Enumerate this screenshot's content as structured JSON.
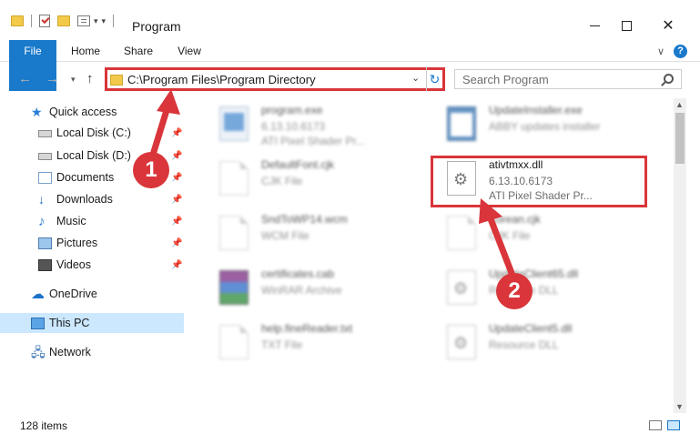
{
  "window": {
    "title": "Program",
    "minimize_icon": "minimize-icon",
    "maximize_icon": "maximize-icon",
    "close_label": "✕"
  },
  "ribbon": {
    "tabs": [
      {
        "label": "File"
      },
      {
        "label": "Home"
      },
      {
        "label": "Share"
      },
      {
        "label": "View"
      }
    ],
    "collapse_label": "∨",
    "help_label": "?"
  },
  "address": {
    "path": "C:\\Program Files\\Program Directory",
    "search_placeholder": "Search Program"
  },
  "nav": {
    "quick_access": "Quick access",
    "items": [
      {
        "label": "Local Disk (C:)"
      },
      {
        "label": "Local Disk (D:)"
      },
      {
        "label": "Documents"
      },
      {
        "label": "Downloads"
      },
      {
        "label": "Music"
      },
      {
        "label": "Pictures"
      },
      {
        "label": "Videos"
      }
    ],
    "onedrive": "OneDrive",
    "this_pc": "This PC",
    "network": "Network"
  },
  "files": [
    {
      "name": "program.exe",
      "line2": "6.13.10.6173",
      "line3": "ATI Pixel Shader Pr...",
      "icon": "exe-icon"
    },
    {
      "name": "UpdateInstaller.exe",
      "line2": "ABBY updates installer",
      "line3": "",
      "icon": "installer-icon"
    },
    {
      "name": "DefaultFont.cjk",
      "line2": "CJK File",
      "line3": "",
      "icon": "file-icon"
    },
    {
      "name": "ativtmxx.dll",
      "line2": "6.13.10.6173",
      "line3": "ATI Pixel Shader Pr...",
      "icon": "dll-gear-icon"
    },
    {
      "name": "SndToWP14.wcm",
      "line2": "WCM File",
      "line3": "",
      "icon": "file-icon"
    },
    {
      "name": "Korean.cjk",
      "line2": "CJK File",
      "line3": "",
      "icon": "file-icon"
    },
    {
      "name": "certificates.cab",
      "line2": "WinRAR Archive",
      "line3": "",
      "icon": "winrar-icon"
    },
    {
      "name": "UpdateClient65.dll",
      "line2": "Resource DLL",
      "line3": "",
      "icon": "dll-gear-icon"
    },
    {
      "name": "help.fineReader.txt",
      "line2": "TXT File",
      "line3": "",
      "icon": "file-icon"
    },
    {
      "name": "UpdateClient5.dll",
      "line2": "Resource DLL",
      "line3": "",
      "icon": "dll-gear-icon"
    }
  ],
  "status": {
    "item_count": "128 items"
  },
  "annotations": {
    "step1": "1",
    "step2": "2",
    "accent_color": "#d9353a"
  },
  "colors": {
    "file_tab": "#1979ca",
    "selection": "#cce8ff"
  }
}
